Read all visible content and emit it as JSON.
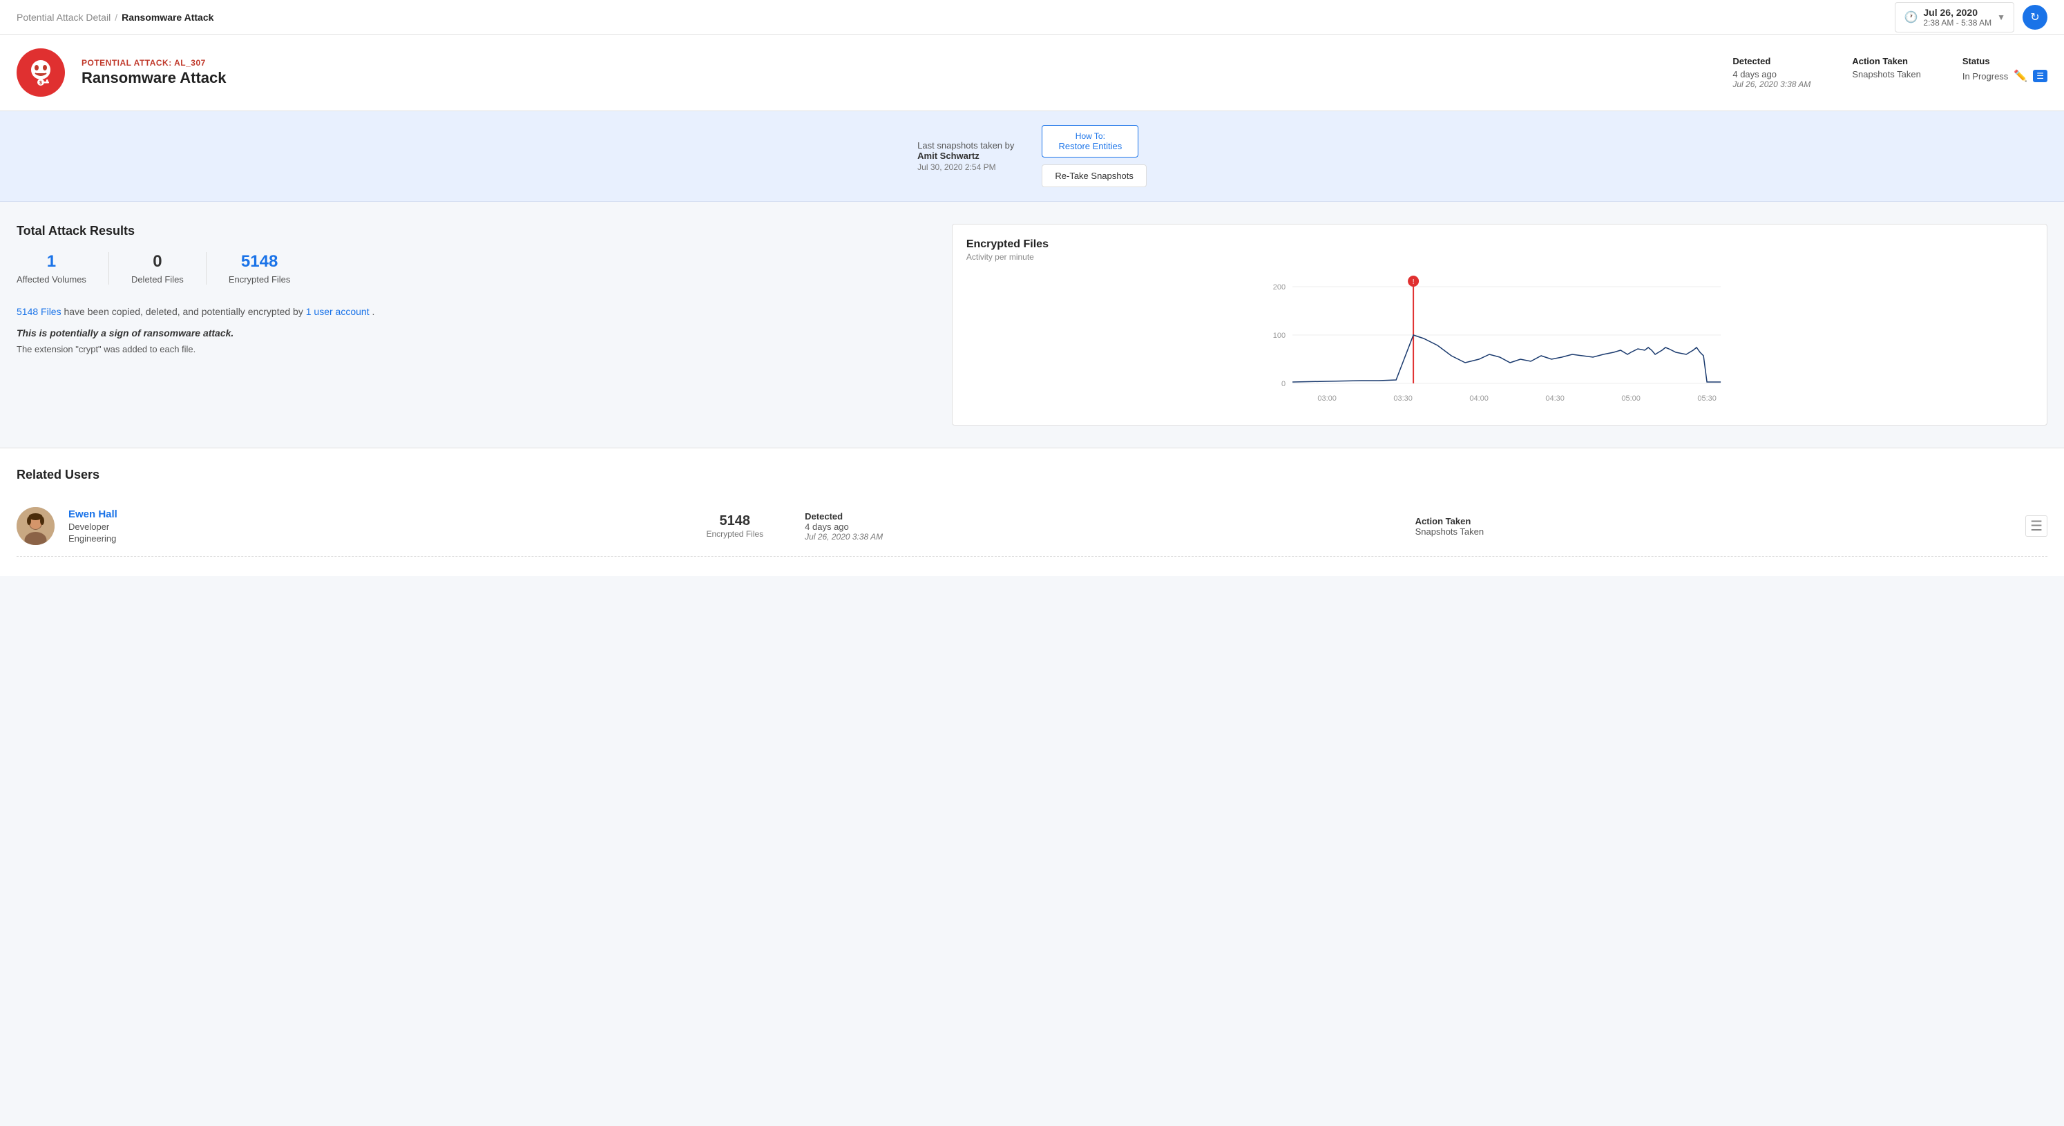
{
  "nav": {
    "breadcrumb_parent": "Potential Attack Detail",
    "breadcrumb_sep": "/",
    "breadcrumb_current": "Ransomware Attack",
    "date_title": "Jul 26, 2020",
    "date_range": "2:38 AM - 5:38 AM"
  },
  "header": {
    "attack_label": "POTENTIAL ATTACK: AL_307",
    "attack_title": "Ransomware Attack",
    "detected_label": "Detected",
    "detected_relative": "4 days ago",
    "detected_date": "Jul 26, 2020 3:38 AM",
    "action_label": "Action Taken",
    "action_value": "Snapshots Taken",
    "status_label": "Status",
    "status_value": "In Progress"
  },
  "snapshot_banner": {
    "last_by_label": "Last snapshots taken by",
    "taken_by": "Amit Schwartz",
    "taken_date": "Jul 30, 2020 2:54 PM",
    "how_to_top": "How To:",
    "how_to_bottom": "Restore Entities",
    "retake_label": "Re-Take Snapshots"
  },
  "attack_results": {
    "section_title": "Total Attack Results",
    "stats": [
      {
        "num": "1",
        "label": "Affected Volumes",
        "blue": true
      },
      {
        "num": "0",
        "label": "Deleted Files",
        "blue": false
      },
      {
        "num": "5148",
        "label": "Encrypted Files",
        "blue": true
      }
    ],
    "desc_link": "5148 Files",
    "desc_text": " have been copied, deleted, and potentially encrypted by ",
    "desc_link2": "1 user account",
    "desc_end": ".",
    "bold_text": "This is potentially a sign of ransomware attack.",
    "ext_text": "The extension \"crypt\" was added to each file."
  },
  "chart": {
    "title": "Encrypted Files",
    "subtitle": "Activity per minute",
    "y_labels": [
      "200",
      "100",
      "0"
    ],
    "x_labels": [
      "03:00",
      "03:30",
      "04:00",
      "04:30",
      "05:00",
      "05:30"
    ]
  },
  "related_users": {
    "section_title": "Related Users",
    "users": [
      {
        "name": "Ewen Hall",
        "role": "Developer",
        "department": "Engineering",
        "stat_num": "5148",
        "stat_label": "Encrypted Files",
        "detected_label": "Detected",
        "detected_relative": "4 days ago",
        "detected_date": "Jul 26, 2020 3:38 AM",
        "action_label": "Action Taken",
        "action_value": "Snapshots Taken"
      }
    ]
  }
}
